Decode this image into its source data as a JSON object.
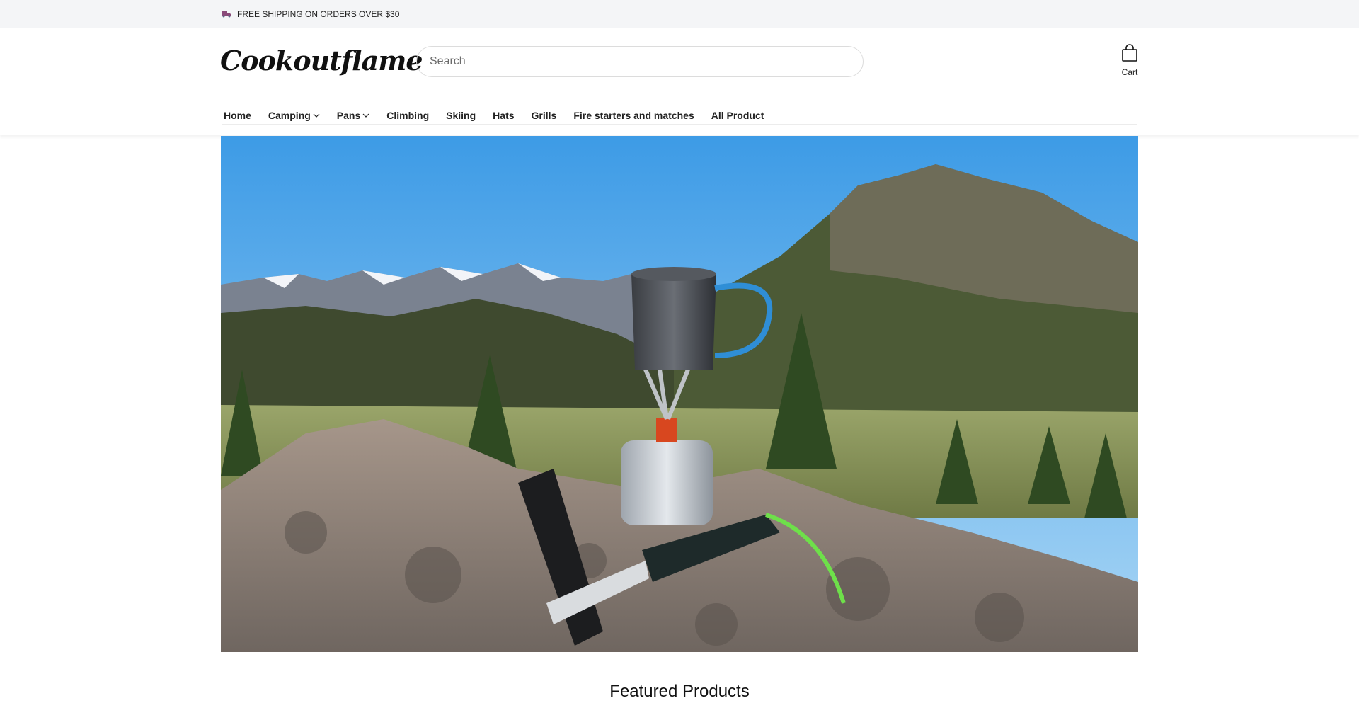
{
  "announcement": {
    "icon": "truck-icon",
    "text": "FREE SHIPPING ON ORDERS OVER $30"
  },
  "header": {
    "logo": "Cookoutflame",
    "search": {
      "placeholder": "Search",
      "value": ""
    },
    "cart": {
      "icon": "shopping-bag-icon",
      "label": "Cart"
    }
  },
  "nav": {
    "items": [
      {
        "label": "Home"
      },
      {
        "label": "Camping",
        "dropdown": true
      },
      {
        "label": "Pans",
        "dropdown": true
      },
      {
        "label": "Climbing"
      },
      {
        "label": "Skiing"
      },
      {
        "label": "Hats"
      },
      {
        "label": "Grills"
      },
      {
        "label": "Fire starters and matches"
      },
      {
        "label": "All Product"
      }
    ]
  },
  "hero": {
    "image": "mountain-camping-stove-scene"
  },
  "featured": {
    "title": "Featured Products"
  },
  "colors": {
    "announcement_bg": "#f4f5f7",
    "text": "#1a1a1a",
    "sky": "#4fa8e8"
  }
}
